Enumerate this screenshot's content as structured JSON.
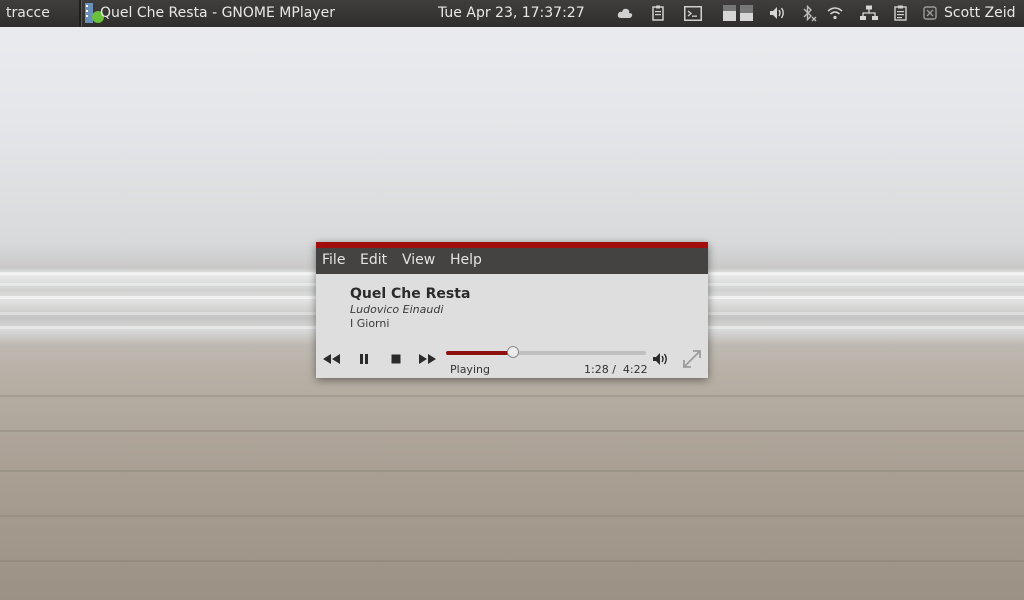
{
  "top_panel": {
    "app_name": "tracce",
    "window_title": "Quel Che Resta - GNOME MPlayer",
    "clock": "Tue Apr 23, 17:37:27",
    "user_name": "Scott Zeid",
    "tray_icons": [
      "cloud-icon",
      "clipboard-icon",
      "terminal-icon",
      "disk-usage-icon",
      "volume-icon",
      "bluetooth-icon",
      "wifi-icon",
      "network-icon",
      "clipboard-manager-icon",
      "user-status-icon"
    ]
  },
  "player": {
    "menu": {
      "file": "File",
      "edit": "Edit",
      "view": "View",
      "help": "Help"
    },
    "track": {
      "title": "Quel Che Resta",
      "artist": "Ludovico Einaudi",
      "album": "I Giorni"
    },
    "status": "Playing",
    "elapsed": "1:28",
    "total": "4:22",
    "time_display": "1:28 /  4:22",
    "progress_fraction": 0.336,
    "accent_color": "#a00e0e",
    "controls": [
      "rewind-icon",
      "pause-icon",
      "stop-icon",
      "fast-forward-icon",
      "volume-icon",
      "fullscreen-icon"
    ]
  }
}
